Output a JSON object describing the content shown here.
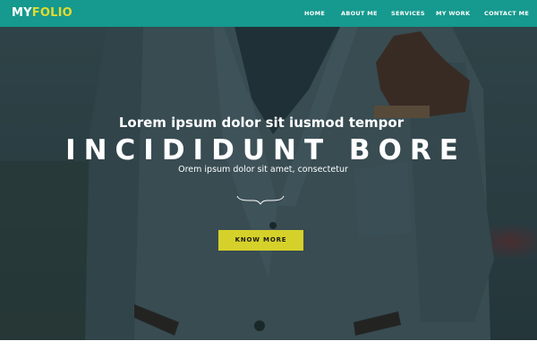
{
  "logo": {
    "part1": "MY",
    "part2": "FOLIO"
  },
  "nav": {
    "items": [
      {
        "label": "HOME"
      },
      {
        "label": "ABOUT ME"
      },
      {
        "label": "SERVICES"
      },
      {
        "label": "MY WORK"
      },
      {
        "label": "CONTACT ME"
      }
    ]
  },
  "hero": {
    "subtitle": "Lorem ipsum dolor sit iusmod tempor",
    "headline": "INCIDIDUNT BORE",
    "tagline": "Orem ipsum dolor sit amet, consectetur",
    "cta_label": "KNOW MORE"
  },
  "colors": {
    "navbar": "#16998e",
    "logo_accent": "#e2dc2e",
    "cta": "#d6d12a"
  }
}
